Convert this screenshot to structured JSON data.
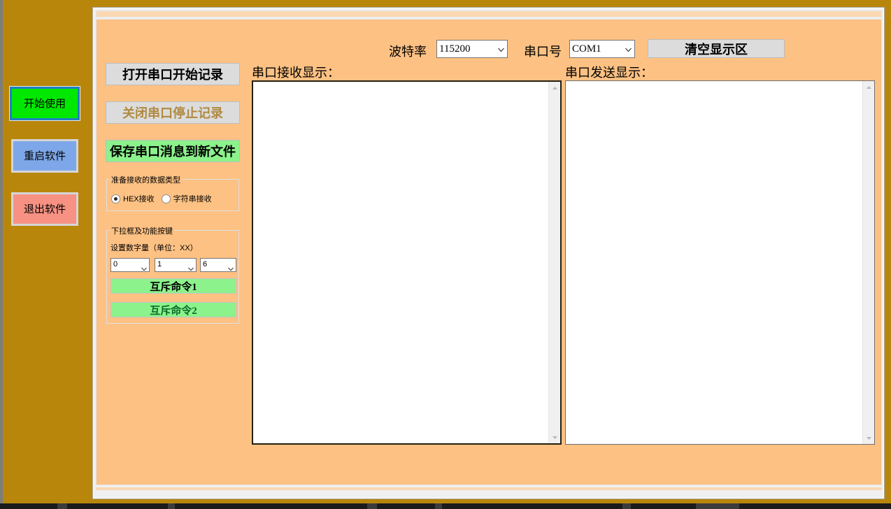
{
  "desktop": {
    "buttons": [
      {
        "id": "start",
        "label": "开始使用",
        "color": "#00e800"
      },
      {
        "id": "restart",
        "label": "重启软件",
        "color": "#7da7e8"
      },
      {
        "id": "quit",
        "label": "退出软件",
        "color": "#f79183"
      }
    ],
    "background_color": "#b8860b"
  },
  "window": {
    "client_background": "#fdc183"
  },
  "toolbar": {
    "baud_label": "波特率",
    "baud_value": "115200",
    "baud_options": [
      "115200"
    ],
    "port_label": "串口号",
    "port_value": "COM1",
    "port_options": [
      "COM1"
    ],
    "clear_button": "清空显示区"
  },
  "controls": {
    "open_button": "打开串口开始记录",
    "close_button": "关闭串口停止记录",
    "save_button": "保存串口消息到新文件",
    "datatype_group": {
      "title": "准备接收的数据类型",
      "options": [
        {
          "label": "HEX接收",
          "checked": true
        },
        {
          "label": "字符串接收",
          "checked": false
        }
      ]
    },
    "dropdown_group": {
      "title": "下拉框及功能按键",
      "numeric_label": "设置数字量（单位：XX）",
      "selects": [
        {
          "value": "0",
          "options": [
            "0"
          ]
        },
        {
          "value": "1",
          "options": [
            "1"
          ]
        },
        {
          "value": "6",
          "options": [
            "6"
          ]
        }
      ],
      "command_buttons": [
        {
          "label": "互斥命令1",
          "text_color": "#000000"
        },
        {
          "label": "互斥命令2",
          "text_color": "#0b6b2a"
        }
      ]
    }
  },
  "display": {
    "receive_label": "串口接收显示：",
    "receive_text": "",
    "send_label": "串口发送显示：",
    "send_text": ""
  }
}
